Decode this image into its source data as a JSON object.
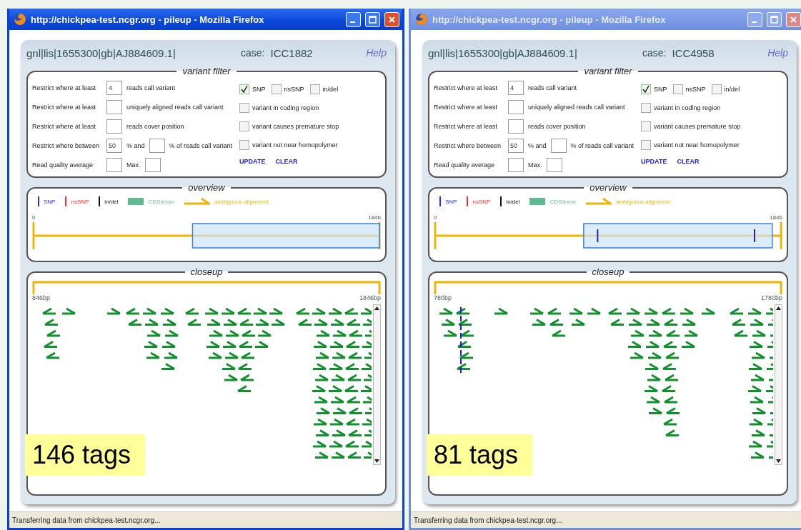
{
  "windows": [
    {
      "title": "http://chickpea-test.ncgr.org - pileup - Mozilla Firefox",
      "active": true,
      "sequence_id": "gnl|lis|1655300|gb|AJ884609.1|",
      "case_label": "case:",
      "case_value": "ICC1882",
      "help": "Help",
      "variant_filter": {
        "legend": "variant filter",
        "rows": [
          {
            "parts": [
              {
                "kind": "text",
                "text": "Restrict where at least"
              },
              {
                "kind": "input",
                "value": "4"
              },
              {
                "kind": "text",
                "text": "reads call variant"
              }
            ]
          },
          {
            "parts": [
              {
                "kind": "text",
                "text": "Restrict where at least"
              },
              {
                "kind": "input"
              },
              {
                "kind": "text",
                "text": "uniquely aligned reads call variant"
              }
            ]
          },
          {
            "parts": [
              {
                "kind": "text",
                "text": "Restrict where at least"
              },
              {
                "kind": "input"
              },
              {
                "kind": "text",
                "text": "reads cover position"
              }
            ]
          },
          {
            "parts": [
              {
                "kind": "text",
                "text": "Restrict where between"
              },
              {
                "kind": "input",
                "value": "50"
              },
              {
                "kind": "text",
                "text": "% and"
              },
              {
                "kind": "input"
              },
              {
                "kind": "text",
                "text": "% of reads call variant"
              }
            ]
          },
          {
            "parts": [
              {
                "kind": "text",
                "text": "Read quality average"
              },
              {
                "kind": "input"
              },
              {
                "kind": "text",
                "text": "Max."
              },
              {
                "kind": "input"
              }
            ]
          }
        ],
        "options": [
          {
            "items": [
              {
                "label": "SNP",
                "checked": true
              },
              {
                "label": "nsSNP",
                "checked": false
              },
              {
                "label": "in/del",
                "checked": false
              }
            ]
          },
          {
            "items": [
              {
                "label": "variant  in coding region",
                "checked": false
              }
            ]
          },
          {
            "items": [
              {
                "label": "variant causes premature stop",
                "checked": false
              }
            ]
          },
          {
            "items": [
              {
                "label": "variant not near homopolymer",
                "checked": false
              }
            ]
          }
        ],
        "actions": [
          "UPDATE",
          "CLEAR"
        ]
      },
      "overview": {
        "legend": "overview",
        "legend_items": [
          {
            "kind": "bar",
            "label": "SNP",
            "color": "#2a2aff"
          },
          {
            "kind": "bar",
            "label": "nsSNP",
            "color": "#ff2a2a"
          },
          {
            "kind": "bar",
            "label": "in/del",
            "color": "#111111"
          },
          {
            "kind": "swatch",
            "label": "CDS/exon",
            "color": "#5dbb8f"
          },
          {
            "kind": "arrow",
            "label": "ambiguous alignment",
            "color": "#f0b400"
          }
        ],
        "start": "0",
        "end": "1846"
      },
      "closeup": {
        "legend": "closeup",
        "start": "846bp",
        "end": "1846bp",
        "tag_count": "146 tags"
      },
      "status": "Transferring data from chickpea-test.ncgr.org..."
    },
    {
      "title": "http://chickpea-test.ncgr.org - pileup - Mozilla Firefox",
      "active": false,
      "sequence_id": "gnl|lis|1655300|gb|AJ884609.1|",
      "case_label": "case:",
      "case_value": "ICC4958",
      "help": "Help",
      "variant_filter": {
        "legend": "variant filter",
        "rows": [
          {
            "parts": [
              {
                "kind": "text",
                "text": "Restrict where at least"
              },
              {
                "kind": "input",
                "value": "4"
              },
              {
                "kind": "text",
                "text": "reads call variant"
              }
            ]
          },
          {
            "parts": [
              {
                "kind": "text",
                "text": "Restrict where at least"
              },
              {
                "kind": "input"
              },
              {
                "kind": "text",
                "text": "uniquely aligned reads call variant"
              }
            ]
          },
          {
            "parts": [
              {
                "kind": "text",
                "text": "Restrict where at least"
              },
              {
                "kind": "input"
              },
              {
                "kind": "text",
                "text": "reads cover position"
              }
            ]
          },
          {
            "parts": [
              {
                "kind": "text",
                "text": "Restrict where between"
              },
              {
                "kind": "input",
                "value": "50"
              },
              {
                "kind": "text",
                "text": "% and"
              },
              {
                "kind": "input"
              },
              {
                "kind": "text",
                "text": "% of reads call variant"
              }
            ]
          },
          {
            "parts": [
              {
                "kind": "text",
                "text": "Read quality average"
              },
              {
                "kind": "input"
              },
              {
                "kind": "text",
                "text": "Max."
              },
              {
                "kind": "input"
              }
            ]
          }
        ],
        "options": [
          {
            "items": [
              {
                "label": "SNP",
                "checked": true
              },
              {
                "label": "nsSNP",
                "checked": false
              },
              {
                "label": "in/del",
                "checked": false
              }
            ]
          },
          {
            "items": [
              {
                "label": "variant  in coding region",
                "checked": false
              }
            ]
          },
          {
            "items": [
              {
                "label": "variant causes premature stop",
                "checked": false
              }
            ]
          },
          {
            "items": [
              {
                "label": "variant not near homopolymer",
                "checked": false
              }
            ]
          }
        ],
        "actions": [
          "UPDATE",
          "CLEAR"
        ]
      },
      "overview": {
        "legend": "overview",
        "legend_items": [
          {
            "kind": "bar",
            "label": "SNP",
            "color": "#2a2aff"
          },
          {
            "kind": "bar",
            "label": "nsSNP",
            "color": "#ff2a2a"
          },
          {
            "kind": "bar",
            "label": "in/del",
            "color": "#111111"
          },
          {
            "kind": "swatch",
            "label": "CDS/exon",
            "color": "#5dbb8f"
          },
          {
            "kind": "arrow",
            "label": "ambiguous alignment",
            "color": "#f0b400"
          }
        ],
        "start": "0",
        "end": "1846"
      },
      "closeup": {
        "legend": "closeup",
        "start": "780bp",
        "end": "1780bp",
        "tag_count": "81 tags"
      },
      "status": "Transferring data from chickpea-test.ncgr.org..."
    }
  ]
}
